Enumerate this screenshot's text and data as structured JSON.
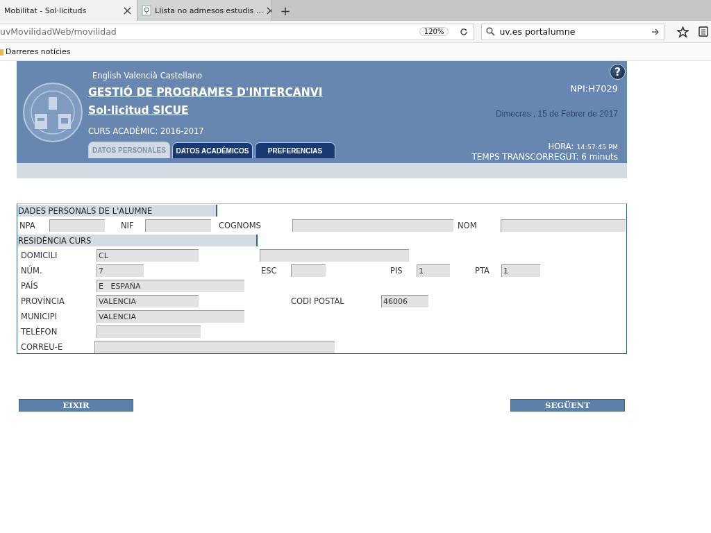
{
  "browser": {
    "tabs": [
      {
        "title": "Mobilitat - Sol·licituds",
        "selected": true
      },
      {
        "title": "Llista no admesos estudis ...",
        "selected": false
      }
    ],
    "new_tab": "+",
    "address": "uvMovilidadWeb/movilidad",
    "zoom": "120%",
    "search": "uv.es portalumne",
    "bookmarks": [
      "Darreres notícies"
    ]
  },
  "header": {
    "languages": [
      "English",
      "Valencià",
      "Castellano"
    ],
    "title": "GESTIÓ DE PROGRAMES D'INTERCANVI",
    "subtitle": "Sol·licitud SICUE",
    "course": "CURS ACADÈMIC: 2016-2017",
    "help": "?",
    "npi": "NPI:H7029",
    "date": "Dimecres , 15 de Febrer de 2017",
    "time_label": "HORA:",
    "time": "14:57:45 PM",
    "elapsed": "TEMPS TRANSCORREGUT: 6 minuts",
    "tabs": [
      {
        "label": "DATOS PERSONALES",
        "selected": true
      },
      {
        "label": "DATOS ACADÉMICOS",
        "selected": false
      },
      {
        "label": "PREFERENCIAS",
        "selected": false
      }
    ]
  },
  "form": {
    "rows": [
      {
        "kind": "section",
        "title": "DADES PERSONALS DE L'ALUMNE"
      },
      {
        "kind": "fields",
        "items": [
          {
            "kind": "label",
            "text": "NPA"
          },
          {
            "kind": "field"
          },
          {
            "kind": "label",
            "text": "NIF"
          },
          {
            "kind": "field"
          },
          {
            "kind": "label",
            "text": "COGNOMS"
          },
          {
            "kind": "field"
          },
          {
            "kind": "label",
            "text": "NOM"
          },
          {
            "kind": "field"
          }
        ]
      },
      {
        "kind": "section",
        "title": "RESIDÈNCIA CURS"
      },
      {
        "kind": "fields",
        "items": [
          {
            "kind": "label",
            "text": "DOMICILI"
          },
          {
            "kind": "field",
            "value": "CL"
          },
          {
            "kind": "field"
          }
        ]
      },
      {
        "kind": "fields",
        "items": [
          {
            "kind": "label",
            "text": "NÚM."
          },
          {
            "kind": "field",
            "value": "7"
          },
          {
            "kind": "label",
            "text": "ESC"
          },
          {
            "kind": "field"
          },
          {
            "kind": "label",
            "text": "PIS"
          },
          {
            "kind": "field",
            "value": "1"
          },
          {
            "kind": "label",
            "text": "PTA"
          },
          {
            "kind": "field",
            "value": "1"
          }
        ]
      },
      {
        "kind": "fields",
        "items": [
          {
            "kind": "label",
            "text": "PAÍS"
          },
          {
            "kind": "field",
            "value": "E   ESPAÑA"
          }
        ]
      },
      {
        "kind": "fields",
        "items": [
          {
            "kind": "label",
            "text": "PROVÍNCIA"
          },
          {
            "kind": "field",
            "value": "VALENCIA"
          },
          {
            "kind": "label",
            "text": "CODI POSTAL"
          },
          {
            "kind": "field",
            "value": "46006"
          }
        ]
      },
      {
        "kind": "fields",
        "items": [
          {
            "kind": "label",
            "text": "MUNICIPI"
          },
          {
            "kind": "field",
            "value": "VALENCIA"
          }
        ]
      },
      {
        "kind": "fields",
        "items": [
          {
            "kind": "label",
            "text": "TELÈFON"
          },
          {
            "kind": "field"
          }
        ]
      },
      {
        "kind": "fields",
        "items": [
          {
            "kind": "label",
            "text": "CORREU-E"
          },
          {
            "kind": "field"
          }
        ]
      }
    ]
  },
  "buttons": [
    "EIXIR",
    "SEGÜENT"
  ]
}
